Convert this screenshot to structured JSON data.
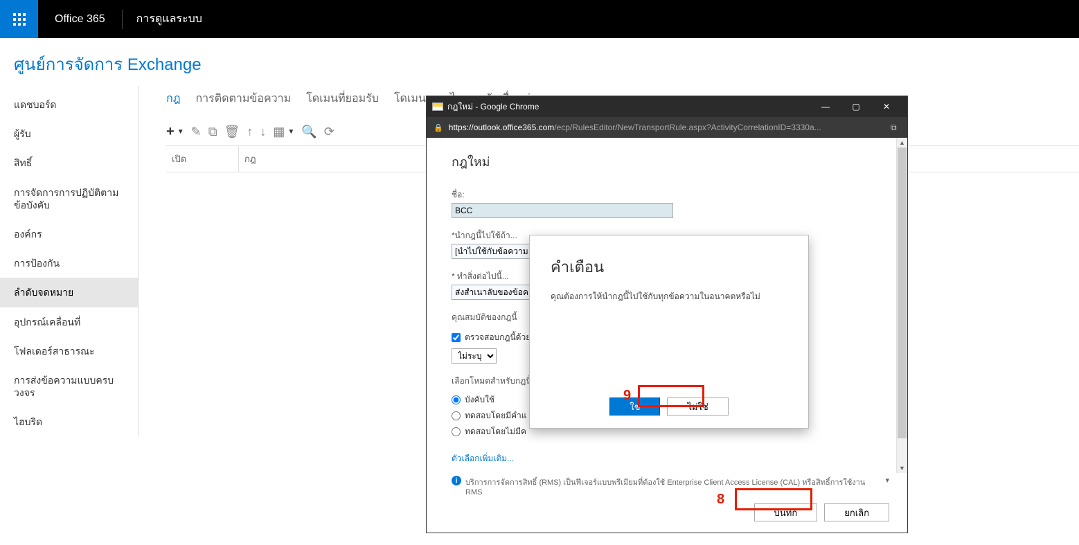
{
  "topbar": {
    "brand": "Office 365",
    "section": "การดูแลระบบ"
  },
  "page_title": "ศูนย์การจัดการ Exchange",
  "sidebar": {
    "items": [
      {
        "label": "แดชบอร์ด"
      },
      {
        "label": "ผู้รับ"
      },
      {
        "label": "สิทธิ์"
      },
      {
        "label": "การจัดการการปฏิบัติตามข้อบังคับ"
      },
      {
        "label": "องค์กร"
      },
      {
        "label": "การป้องกัน"
      },
      {
        "label": "ลำดับจดหมาย"
      },
      {
        "label": "อุปกรณ์เคลื่อนที่"
      },
      {
        "label": "โฟลเดอร์สาธารณะ"
      },
      {
        "label": "การส่งข้อความแบบครบวงจร"
      },
      {
        "label": "ไฮบริด"
      }
    ],
    "active_index": 6
  },
  "tabs": {
    "items": [
      "กฎ",
      "การติดตามข้อความ",
      "โดเมนที่ยอมรับ",
      "โดเมนระยะไกล",
      "ตัวเชื่อมต่อ"
    ],
    "active_index": 0
  },
  "grid": {
    "col1": "เปิด",
    "col2": "กฎ"
  },
  "popup": {
    "title": "กฎใหม่ - Google Chrome",
    "url_host": "https://outlook.office365.com",
    "url_path": "/ecp/RulesEditor/NewTransportRule.aspx?ActivityCorrelationID=3330a...",
    "heading": "กฎใหม่",
    "name_label": "ชื่อ:",
    "name_value": "BCC",
    "apply_label": "*นำกฎนี้ไปใช้ถ้า...",
    "apply_value": "[นำไปใช้กับข้อความ",
    "do_label": "* ทำสิ่งต่อไปนี้...",
    "do_value": "ส่งสำเนาลับของข้อค",
    "properties_label": "คุณสมบัติของกฎนี้",
    "audit_checkbox_label": "ตรวจสอบกฎนี้ด้วย",
    "audit_select_value": "ไม่ระบุ",
    "mode_label": "เลือกโหมดสำหรับกฎนี้",
    "radio_items": [
      "บังคับใช้",
      "ทดสอบโดยมีคำแ",
      "ทดสอบโดยไม่มีค"
    ],
    "more_options": "ตัวเลือกเพิ่มเติม...",
    "info_text": "บริการการจัดการสิทธิ์ (RMS) เป็นฟีเจอร์แบบพรีเมียมที่ต้องใช้ Enterprise Client Access License (CAL) หรือสิทธิ์การใช้งาน RMS",
    "save_label": "บันทึก",
    "cancel_label": "ยกเลิก"
  },
  "warn": {
    "title": "คำเตือน",
    "text": "คุณต้องการให้นำกฎนี้ไปใช้กับทุกข้อความในอนาคตหรือไม่",
    "yes_label": "ใช่",
    "no_label": "ไม่ใช่"
  },
  "annotations": {
    "label_8": "8",
    "label_9": "9"
  }
}
